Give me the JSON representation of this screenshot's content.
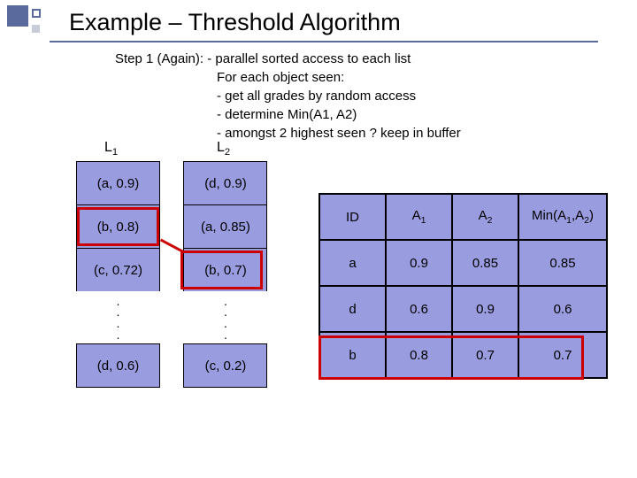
{
  "title": "Example – Threshold Algorithm",
  "step": {
    "line1": "Step 1 (Again): - parallel sorted access to each list",
    "line2": "For each object seen:",
    "line3": "- get all grades by random access",
    "line4": "- determine Min(A1, A2)",
    "line5": "- amongst 2 highest seen ? keep in buffer"
  },
  "labels": {
    "l1": "L",
    "l1sub": "1",
    "l2": "L",
    "l2sub": "2"
  },
  "list1": [
    "(a, 0.9)",
    "(b, 0.8)",
    "(c, 0.72)",
    "....",
    "(d, 0.6)"
  ],
  "list2": [
    "(d, 0.9)",
    "(a, 0.85)",
    "(b, 0.7)",
    "....",
    "(c, 0.2)"
  ],
  "rheaders": {
    "id": "ID",
    "a1": "A",
    "a1sub": "1",
    "a2": "A",
    "a2sub": "2",
    "min": "Min(A",
    "min1": "1",
    "mincomma": ",A",
    "min2": "2",
    "minend": ")"
  },
  "rows": [
    {
      "id": "a",
      "a1": "0.9",
      "a2": "0.85",
      "min": "0.85"
    },
    {
      "id": "d",
      "a1": "0.6",
      "a2": "0.9",
      "min": "0.6"
    },
    {
      "id": "b",
      "a1": "0.8",
      "a2": "0.7",
      "min": "0.7"
    }
  ]
}
